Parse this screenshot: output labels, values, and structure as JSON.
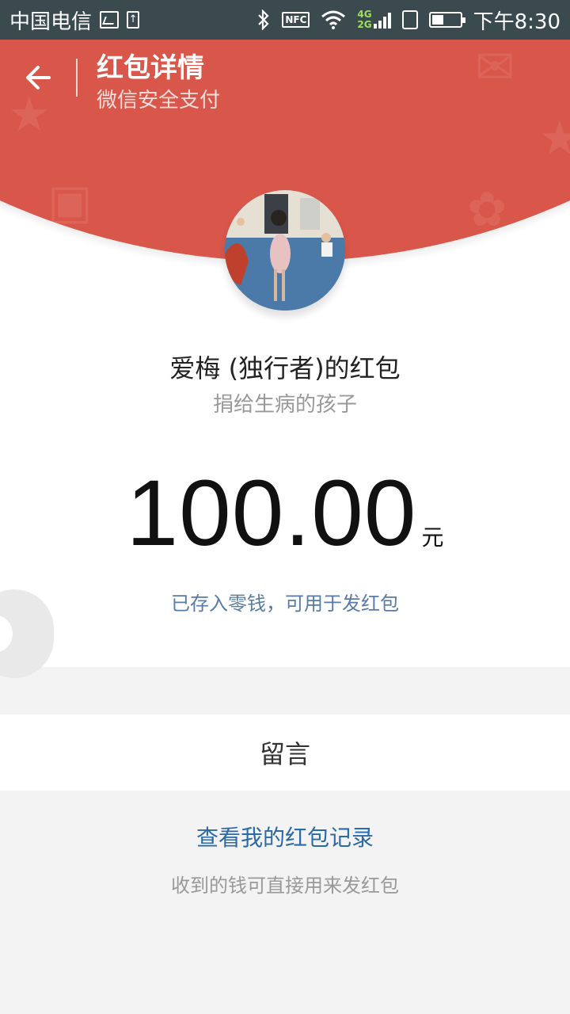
{
  "status_bar": {
    "carrier": "中国电信",
    "network_top": "4G",
    "network_bottom": "2G",
    "nfc": "NFC",
    "time": "下午8:30"
  },
  "header": {
    "title": "红包详情",
    "subtitle": "微信安全支付"
  },
  "packet": {
    "sender": "爱梅 (独行者)的红包",
    "wish": "捐给生病的孩子",
    "amount": "100.00",
    "unit": "元",
    "saved_note": "已存入零钱，可用于发红包"
  },
  "message": {
    "label": "留言"
  },
  "footer": {
    "record_link": "查看我的红包记录",
    "hint": "收到的钱可直接用来发红包"
  },
  "colors": {
    "header_red": "#d9574a",
    "link_blue": "#2b6aa8",
    "status_bar": "#3a4a4f"
  },
  "icons": [
    "back-arrow-icon",
    "image-icon",
    "upload-icon",
    "bluetooth-icon",
    "nfc-icon",
    "wifi-icon",
    "signal-icon",
    "sim-icon",
    "battery-icon"
  ]
}
